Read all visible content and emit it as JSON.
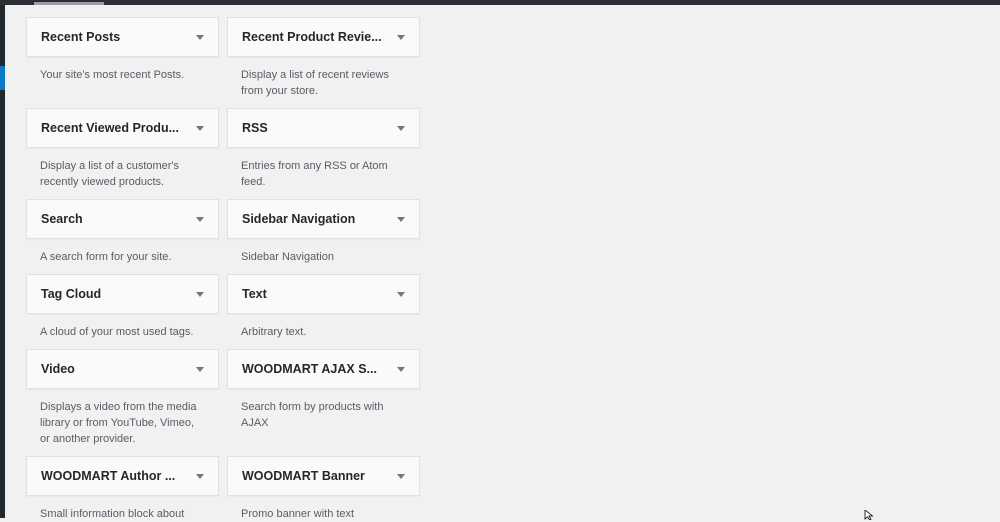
{
  "widgets": [
    {
      "title": "Recent Posts",
      "desc": "Your site's most recent Posts."
    },
    {
      "title": "Recent Product Revie...",
      "desc": "Display a list of recent reviews from your store."
    },
    {
      "title": "Recent Viewed Produ...",
      "desc": "Display a list of a customer's recently viewed products."
    },
    {
      "title": "RSS",
      "desc": "Entries from any RSS or Atom feed."
    },
    {
      "title": "Search",
      "desc": "A search form for your site."
    },
    {
      "title": "Sidebar Navigation",
      "desc": "Sidebar Navigation"
    },
    {
      "title": "Tag Cloud",
      "desc": "A cloud of your most used tags."
    },
    {
      "title": "Text",
      "desc": "Arbitrary text."
    },
    {
      "title": "Video",
      "desc": "Displays a video from the media library or from YouTube, Vimeo, or another provider."
    },
    {
      "title": "WOODMART AJAX S...",
      "desc": "Search form by products with AJAX"
    },
    {
      "title": "WOODMART Author ...",
      "desc": "Small information block about"
    },
    {
      "title": "WOODMART Banner",
      "desc": "Promo banner with text"
    }
  ],
  "colors": {
    "background": "#f1f1f1",
    "admin_bar": "#2b2f33",
    "accent": "#0a7ac7"
  },
  "icons": {
    "widget_toggle": "arrow-down-icon",
    "mouse": "mouse-cursor-icon"
  }
}
